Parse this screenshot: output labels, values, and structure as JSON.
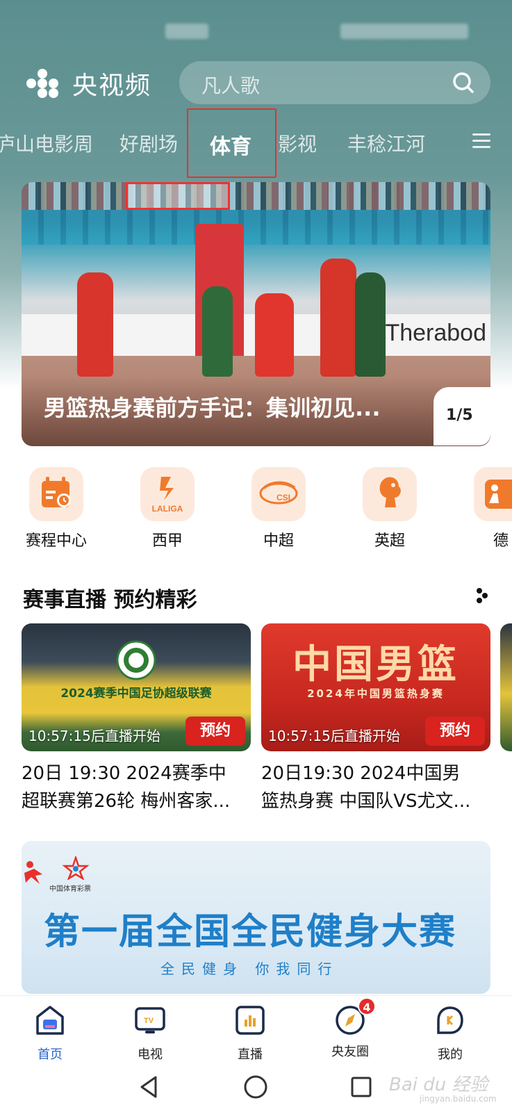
{
  "app": {
    "name": "央视频"
  },
  "search": {
    "placeholder": "凡人歌"
  },
  "tabs": [
    {
      "label": "庐山电影周"
    },
    {
      "label": "好剧场"
    },
    {
      "label": "体育",
      "active": true
    },
    {
      "label": "影视"
    },
    {
      "label": "丰稔江河"
    }
  ],
  "banner": {
    "caption": "男篮热身赛前方手记：集训初见...",
    "counter": "1/5",
    "ad_text": "Therabod"
  },
  "leagues": [
    {
      "label": "赛程中心",
      "icon": "calendar-icon"
    },
    {
      "label": "西甲",
      "icon": "laliga-icon",
      "icon_text": "LALIGA"
    },
    {
      "label": "中超",
      "icon": "csl-icon",
      "icon_text": "CSL"
    },
    {
      "label": "英超",
      "icon": "premier-league-icon"
    },
    {
      "label": "德",
      "icon": "bundesliga-icon"
    }
  ],
  "section": {
    "title": "赛事直播 预约精彩"
  },
  "cards": [
    {
      "image_text": "2024赛季中国足协超级联赛",
      "countdown": "10:57:15后直播开始",
      "button": "预约",
      "title_line1": "20日 19:30 2024赛季中",
      "title_line2": "超联赛第26轮 梅州客家..."
    },
    {
      "image_text": "中国男篮",
      "image_sub": "2024年中国男篮热身赛",
      "countdown": "10:57:15后直播开始",
      "button": "预约",
      "title_line1": "20日19:30 2024中国男",
      "title_line2": "篮热身赛 中国队VS尤文..."
    }
  ],
  "promo": {
    "title": "第一届全国全民健身大赛",
    "subtitle": "全民健身 你我同行",
    "logo_caption": "中国体育彩票"
  },
  "bottom_nav": [
    {
      "label": "首页",
      "icon": "home-icon",
      "active": true
    },
    {
      "label": "电视",
      "icon": "tv-icon"
    },
    {
      "label": "直播",
      "icon": "live-icon"
    },
    {
      "label": "央友圈",
      "icon": "compass-icon",
      "badge": "4"
    },
    {
      "label": "我的",
      "icon": "profile-icon"
    }
  ],
  "watermark": {
    "text": "Bai du 经验",
    "sub": "jingyan.baidu.com"
  },
  "colors": {
    "accent": "#2764c9",
    "reserve_button": "#d8231f",
    "header_bg": "#5b8f8f",
    "highlight_box": "#e8312a"
  }
}
